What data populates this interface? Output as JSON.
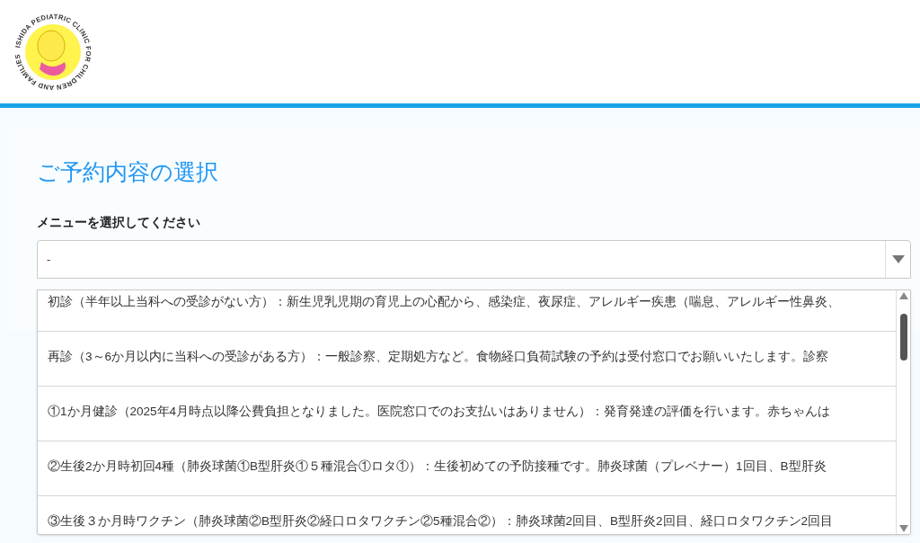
{
  "logo": {
    "text": "ISHIDA PEDIATRIC CLINIC FOR CHILDREN AND FAMILIES"
  },
  "heading": "ご予約内容の選択",
  "menu_label": "メニューを選択してください",
  "select": {
    "value": "-",
    "expanded": true
  },
  "options": [
    {
      "label": "初診（半年以上当科への受診がない方）：新生児乳児期の育児上の心配から、感染症、夜尿症、アレルギー疾患（喘息、アレルギー性鼻炎、",
      "selected": false
    },
    {
      "label": "再診（3～6か月以内に当科への受診がある方）：一般診察、定期処方など。食物経口負荷試験の予約は受付窓口でお願いいたします。診察",
      "selected": false
    },
    {
      "label": "①1か月健診（2025年4月時点以降公費負担となりました。医院窓口でのお支払いはありません）：発育発達の評価を行います。赤ちゃんは",
      "selected": false
    },
    {
      "label": "②生後2か月時初回4種（肺炎球菌①B型肝炎①５種混合①ロタ①）：生後初めての予防接種です。肺炎球菌（プレベナー）1回目、B型肝炎",
      "selected": false
    },
    {
      "label": "③生後３か月時ワクチン（肺炎球菌②B型肝炎②経口ロタワクチン②5種混合②）：肺炎球菌2回目、B型肝炎2回目、経口ロタワクチン2回目",
      "selected": false
    }
  ]
}
